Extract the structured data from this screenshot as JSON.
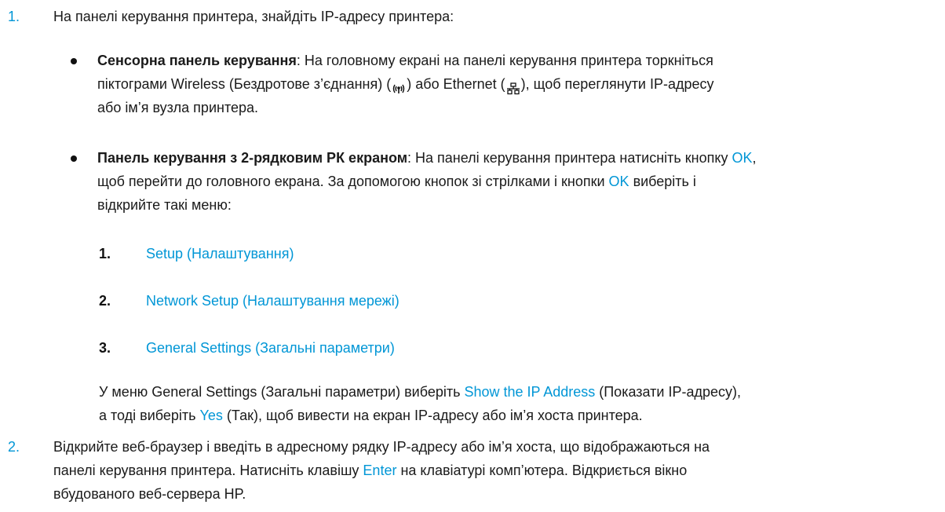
{
  "step1": {
    "number": "1.",
    "text": "На панелі керування принтера, знайдіть IP-адресу принтера:"
  },
  "bullet1": {
    "title": "Сенсорна панель керування",
    "text_a": ": На головному екрані на панелі керування принтера торкніться",
    "text_b_pre": "піктограми Wireless (Бездротове з’єднання) (",
    "text_b_mid": ") або Ethernet (",
    "text_b_post": "), щоб переглянути IP-адресу",
    "text_c": "або ім’я вузла принтера.",
    "icons": [
      "wireless-icon",
      "ethernet-icon"
    ]
  },
  "bullet2": {
    "title": "Панель керування з 2-рядковим РК екраном",
    "text_a": ": На панелі керування принтера натисніть кнопку ",
    "ok1": "OK",
    "text_a_end": ",",
    "text_b_pre": "щоб перейти до головного екрана. За допомогою кнопок зі стрілками і кнопки ",
    "ok2": "OK",
    "text_b_post": " виберіть і",
    "text_c": "відкрийте такі меню:"
  },
  "submenu": [
    {
      "num": "1.",
      "label": "Setup (Налаштування)"
    },
    {
      "num": "2.",
      "label": "Network Setup (Налаштування мережі)"
    },
    {
      "num": "3.",
      "label": "General Settings (Загальні параметри)"
    }
  ],
  "paragraph": {
    "line1_pre": "У меню General Settings (Загальні параметри) виберіть ",
    "line1_link": "Show the IP Address",
    "line1_post": " (Показати IP-адресу),",
    "line2_pre": "а тоді виберіть ",
    "line2_link": "Yes",
    "line2_post": " (Так), щоб вивести на екран IP-адресу або ім’я хоста принтера."
  },
  "step2": {
    "number": "2.",
    "line1": "Відкрийте веб-браузер і введіть в адресному рядку IP-адресу або ім’я хоста, що відображаються на",
    "line2_pre": "панелі керування принтера. Натисніть клавішу ",
    "line2_link": "Enter",
    "line2_post": " на клавіатурі комп’ютера. Відкриється вікно",
    "line3": "вбудованого веб-сервера HP."
  },
  "colors": {
    "accent": "#0096d6",
    "text": "#1a1a1a"
  }
}
